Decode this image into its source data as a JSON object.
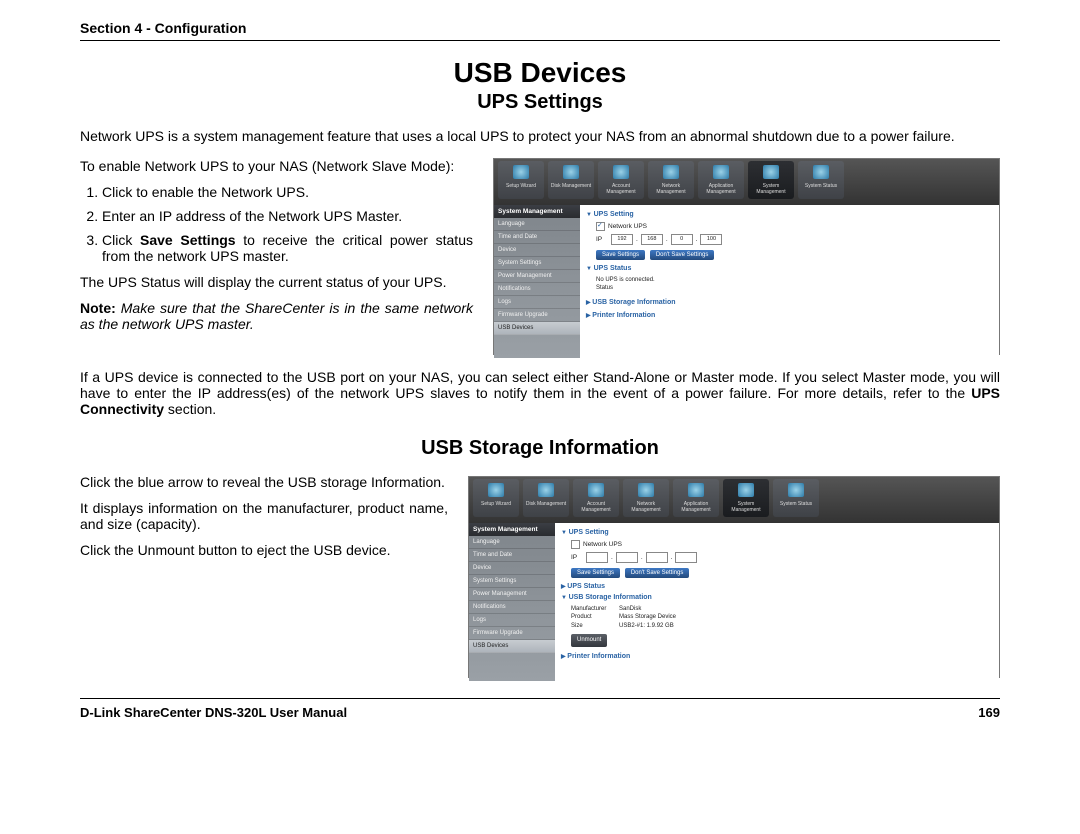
{
  "header": "Section 4 - Configuration",
  "title": "USB Devices",
  "subtitle": "UPS Settings",
  "intro": "Network UPS is a system management feature that uses a local UPS to protect your NAS from an abnormal shutdown due to a power failure.",
  "ups": {
    "enable_line": "To enable Network UPS to your NAS (Network Slave Mode):",
    "step1": "Click to enable the Network UPS.",
    "step2": "Enter an IP address of the Network UPS Master.",
    "step3_pre": "Click ",
    "step3_bold": "Save Settings",
    "step3_post": " to receive the critical power status from the network UPS master.",
    "status_line": "The UPS Status will display the current status of your UPS.",
    "note_label": "Note:",
    "note_body": " Make sure that the ShareCenter is in the same network as the network UPS master.",
    "closing_pre": "If a UPS device is connected to the USB port on your NAS, you can select either Stand-Alone or Master mode. If you select Master mode, you will have to enter the IP address(es) of the network UPS slaves to notify them in the event of a power failure. For more details, refer to the ",
    "closing_bold": "UPS Connectivity",
    "closing_post": " section."
  },
  "usb": {
    "heading": "USB Storage Information",
    "line1": "Click the blue arrow to reveal the USB storage Information.",
    "line2": "It displays information on the manufacturer, product name, and size (capacity).",
    "line3": "Click the Unmount button to eject the USB device."
  },
  "shot": {
    "toolbar": [
      "Setup Wizard",
      "Disk Management",
      "Account Management",
      "Network Management",
      "Application Management",
      "System Management",
      "System Status"
    ],
    "side_h": "System Management",
    "side_items": [
      "Language",
      "Time and Date",
      "Device",
      "System Settings",
      "Power Management",
      "Notifications",
      "Logs",
      "Firmware Upgrade",
      "USB Devices"
    ],
    "panel_ups_setting": "UPS Setting",
    "cb_label": "Network UPS",
    "ip_label": "IP",
    "ip": [
      "192",
      "168",
      "0",
      "100"
    ],
    "ip_blank": [
      "",
      "",
      "",
      ""
    ],
    "btn_save": "Save Settings",
    "btn_dont": "Don't Save Settings",
    "btn_unmount": "Unmount",
    "panel_ups_status": "UPS Status",
    "status_no_ups": "No UPS is connected.",
    "status_label": "Status",
    "panel_usb_storage": "USB Storage Information",
    "panel_printer": "Printer Information",
    "kv": {
      "manuf_k": "Manufacturer",
      "manuf_v": "SanDisk",
      "prod_k": "Product",
      "prod_v": "Mass Storage Device",
      "size_k": "Size",
      "size_v": "USB2-#1: 1.9.92 GB"
    }
  },
  "footer": {
    "left": "D-Link ShareCenter DNS-320L User Manual",
    "right": "169"
  }
}
